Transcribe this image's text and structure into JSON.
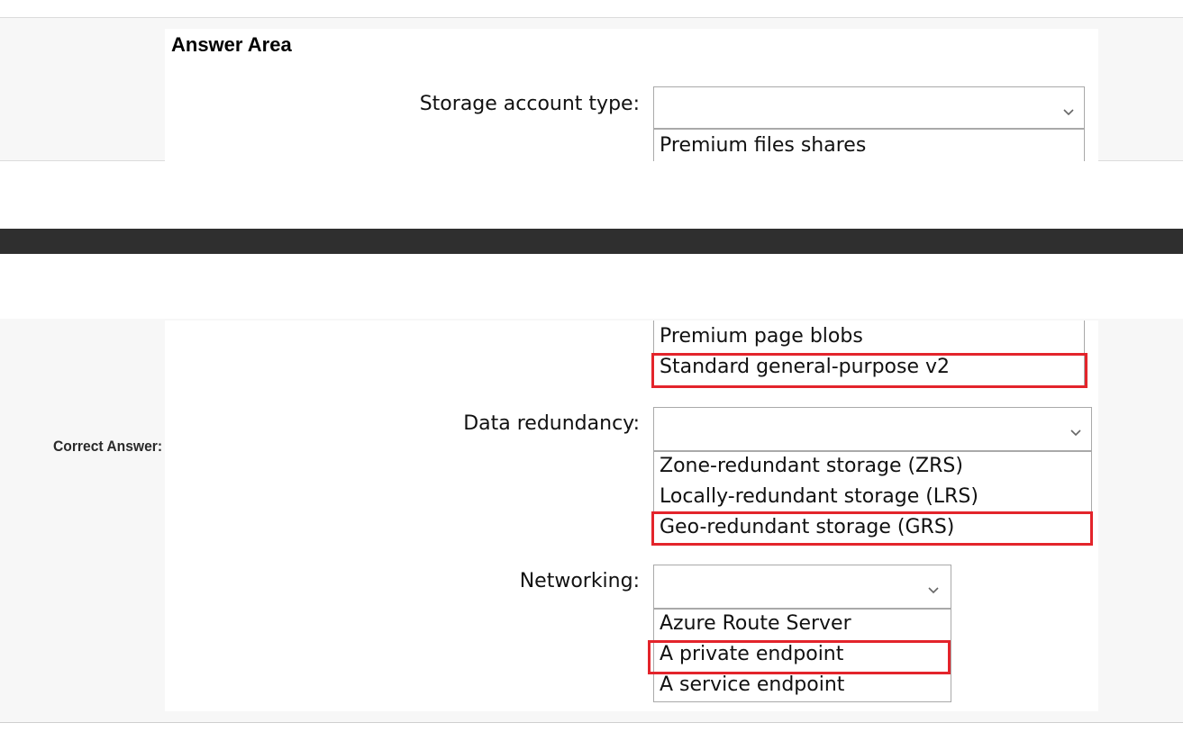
{
  "answer_area": {
    "title": "Answer Area"
  },
  "correct_answer": {
    "label": "Correct Answer:"
  },
  "storage": {
    "label": "Storage account type:",
    "selected": "",
    "options": [
      "Premium files shares",
      "Premium page blobs",
      "Standard general-purpose v2"
    ],
    "correct": "Standard general-purpose v2"
  },
  "redundancy": {
    "label": "Data redundancy:",
    "selected": "",
    "options": [
      "Zone-redundant storage (ZRS)",
      "Locally-redundant storage (LRS)",
      "Geo-redundant storage (GRS)"
    ],
    "correct": "Geo-redundant storage (GRS)"
  },
  "networking": {
    "label": "Networking:",
    "selected": "",
    "options": [
      "Azure Route Server",
      "A private endpoint",
      "A service endpoint"
    ],
    "correct": "A private endpoint"
  },
  "colors": {
    "highlight": "#e3242b",
    "band": "#2f2f2f",
    "panel": "#f7f7f7"
  },
  "icons": {
    "dropdown": "chevron-down-icon"
  }
}
